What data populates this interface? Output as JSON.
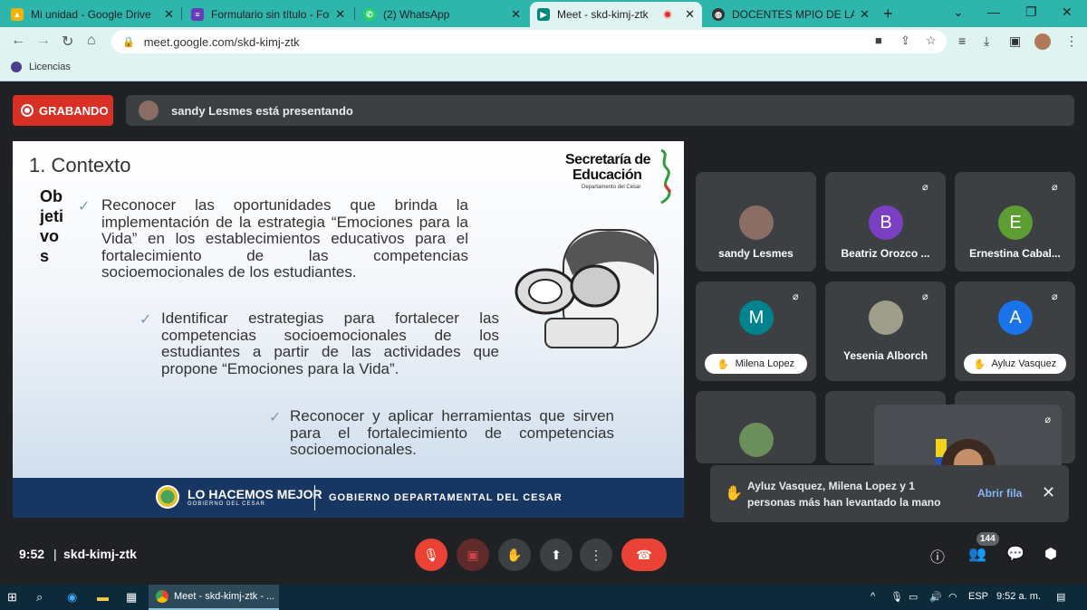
{
  "browser": {
    "tabs": [
      {
        "title": "Mi unidad - Google Drive",
        "favicon": "google-drive",
        "color": "#f4b400"
      },
      {
        "title": "Formulario sin título - Formu",
        "favicon": "google-forms",
        "color": "#673ab7"
      },
      {
        "title": "(2) WhatsApp",
        "favicon": "whatsapp",
        "color": "#25d366"
      },
      {
        "title": "Meet - skd-kimj-ztk",
        "favicon": "google-meet",
        "color": "#00897b",
        "active": true
      },
      {
        "title": "DOCENTES MPIO DE LA PAZ",
        "favicon": "globe",
        "color": "#333333"
      }
    ],
    "url": "meet.google.com/skd-kimj-ztk",
    "bookmark": "Licencias"
  },
  "meet": {
    "recording_label": "GRABANDO",
    "presenting_text": "sandy Lesmes está presentando",
    "meeting_time": "9:52",
    "meeting_code": "skd-kimj-ztk",
    "people_count": "144"
  },
  "slide": {
    "title": "1. Contexto",
    "logo_line1": "Secretaría de",
    "logo_line2": "Educación",
    "logo_line3": "Departamento del Cesar",
    "objetivos": "Ob jeti vo s",
    "bullets": [
      "Reconocer las oportunidades que brinda la implementación de la estrategia “Emociones para la Vida” en los establecimientos educativos para el fortalecimiento de las competencias socioemocionales de los estudiantes.",
      "Identificar estrategias para fortalecer las competencias socioemocionales de los estudiantes a partir de las actividades que propone “Emociones para la Vida”.",
      "Reconocer y aplicar herramientas que sirven para el fortalecimiento de competencias socioemocionales."
    ],
    "footer_brand": "LO HACEMOS MEJOR",
    "footer_brand_sub": "GOBIERNO DEL CESAR",
    "footer_gov": "GOBIERNO DEPARTAMENTAL DEL CESAR"
  },
  "participants": [
    {
      "name": "sandy Lesmes",
      "initial": "",
      "color": "#8a6d63",
      "muted": false,
      "hand": false
    },
    {
      "name": "Beatriz Orozco ...",
      "initial": "B",
      "color": "#7b3fc4",
      "muted": true,
      "hand": false
    },
    {
      "name": "Ernestina Cabal...",
      "initial": "E",
      "color": "#5c9e31",
      "muted": true,
      "hand": false
    },
    {
      "name": "Milena Lopez",
      "initial": "M",
      "color": "#00838f",
      "muted": true,
      "hand": true
    },
    {
      "name": "Yesenia Alborch",
      "initial": "",
      "color": "#9e9e8a",
      "muted": true,
      "hand": false
    },
    {
      "name": "Ayluz Vasquez",
      "initial": "A",
      "color": "#1a73e8",
      "muted": true,
      "hand": true
    }
  ],
  "toast": {
    "message": "Ayluz Vasquez, Milena Lopez y 1 personas más han levantado la mano",
    "action": "Abrir fila"
  },
  "taskbar": {
    "app_label": "Meet - skd-kimj-ztk - ...",
    "lang": "ESP",
    "clock": "9:52 a. m."
  }
}
